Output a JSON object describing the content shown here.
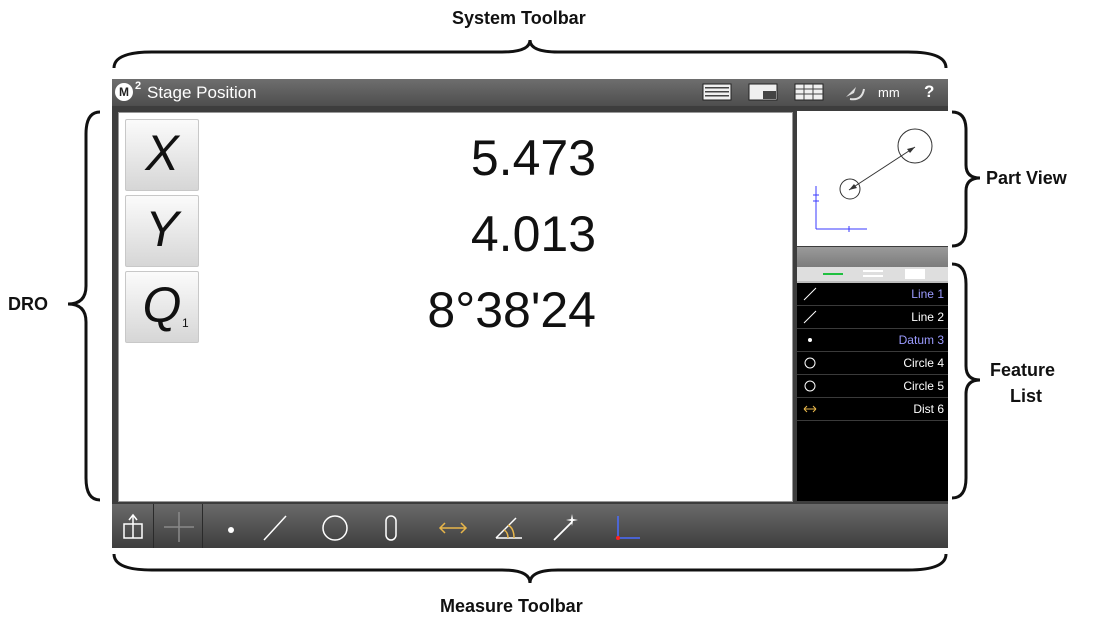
{
  "annotations": {
    "system_toolbar": "System Toolbar",
    "part_view": "Part View",
    "dro": "DRO",
    "feature_list_line1": "Feature",
    "feature_list_line2": "List",
    "measure_toolbar": "Measure Toolbar"
  },
  "system_toolbar": {
    "logo_letter": "M",
    "logo_superscript": "2",
    "title": "Stage Position",
    "units": "mm",
    "help": "?",
    "icons": [
      "dro-display-icon",
      "part-view-icon",
      "feature-table-icon",
      "undo-icon"
    ]
  },
  "dro": {
    "axes": [
      {
        "label": "X",
        "subscript": "",
        "value": "5.473"
      },
      {
        "label": "Y",
        "subscript": "",
        "value": "4.013"
      },
      {
        "label": "Q",
        "subscript": "1",
        "value": "8°38'24"
      }
    ]
  },
  "feature_list": {
    "tabs": [
      "line-tab-icon",
      "list-tab-icon",
      "blank-tab-icon"
    ],
    "items": [
      {
        "type": "line",
        "label": "Line 1",
        "color": "#9b9bff"
      },
      {
        "type": "line",
        "label": "Line 2",
        "color": "#ffffff"
      },
      {
        "type": "point",
        "label": "Datum 3",
        "color": "#9b9bff"
      },
      {
        "type": "circle",
        "label": "Circle 4",
        "color": "#ffffff"
      },
      {
        "type": "circle",
        "label": "Circle 5",
        "color": "#ffffff"
      },
      {
        "type": "distance",
        "label": "Dist 6",
        "color": "#ffffff"
      }
    ]
  },
  "measure_toolbar": {
    "tools": [
      "probe-icon",
      "crosshair-icon",
      "point-icon",
      "line-icon",
      "circle-icon",
      "slot-icon",
      "distance-icon",
      "angle-icon",
      "magic-wand-icon",
      "skew-icon"
    ]
  },
  "colors": {
    "toolbar": "#5a5a5a",
    "distance_tool": "#e8b64a",
    "selected_text": "#9b9bff",
    "part_view_datum": "#3a3aff",
    "axis_red": "#ff2020",
    "tab_green": "#20c040"
  }
}
